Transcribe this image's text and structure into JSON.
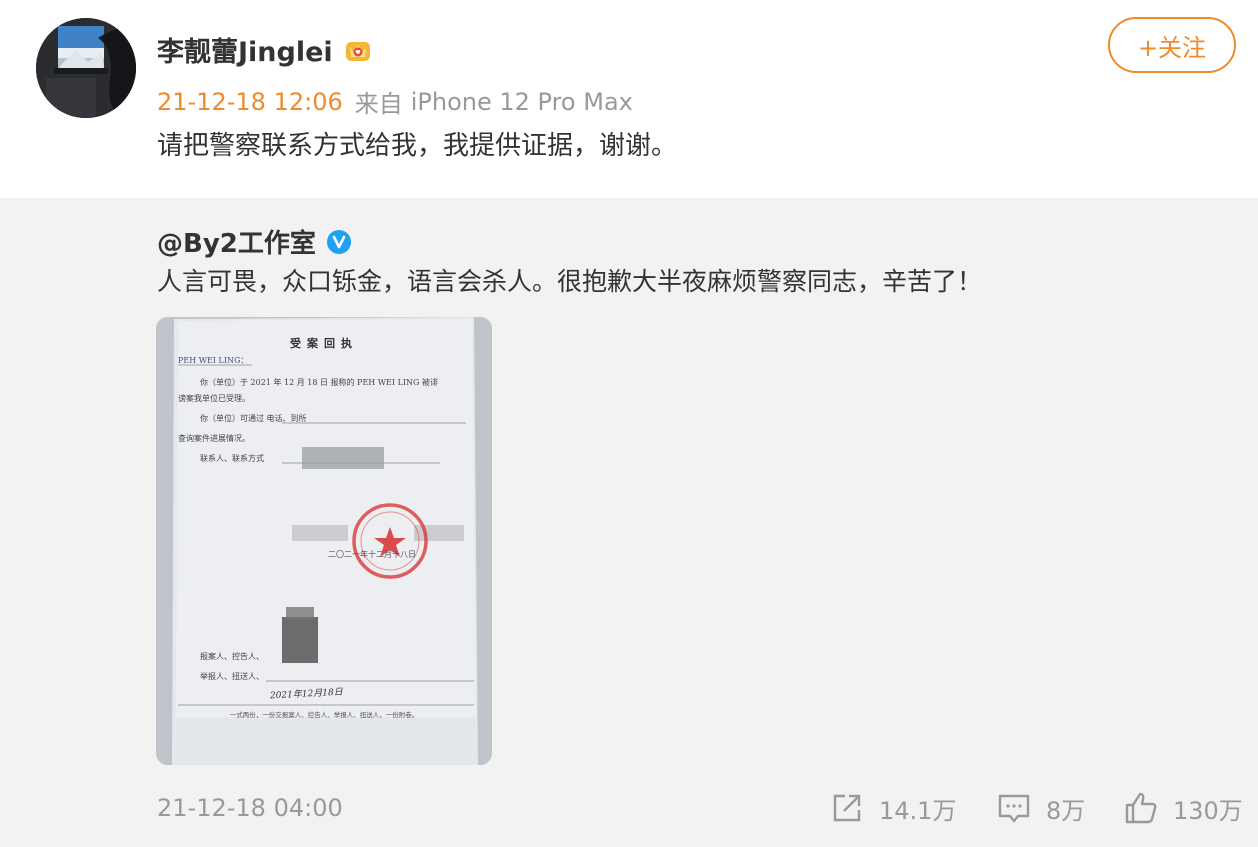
{
  "post": {
    "author": "李靓蕾Jinglei",
    "badge_icon": "crown-badge-icon",
    "follow_label": "+关注",
    "time": "21-12-18 12:06",
    "source_prefix": "来自",
    "device": "iPhone 12 Pro Max",
    "text": "请把警察联系方式给我，我提供证据，谢谢。"
  },
  "repost": {
    "author": "@By2工作室",
    "verified_icon": "verified-check-icon",
    "text": "人言可畏，众口铄金，语言会杀人。很抱歉大半夜麻烦警察同志，辛苦了！",
    "image": {
      "title": "受案回执",
      "line_name": "PEH WEI LING：",
      "line_1": "你（单位）于 2021 年 12 月 18 日 报称的 PEH WEI LING 被诽",
      "line_2": "谤案我单位已受理。",
      "line_3": "你（单位）可通过 电话、到所",
      "line_4": "查询案件进展情况。",
      "line_5": "联系人、联系方式",
      "date_line": "二〇二一年十二月十八日",
      "line_6": "报案人、控告人、",
      "line_7": "举报人、扭送人、",
      "hand_date": "2021年12月18日",
      "footer": "一式两份，一份交报案人、控告人、举报人、扭送人，一份附卷。"
    },
    "time": "21-12-18 04:00",
    "share_count": "14.1万",
    "comment_count": "8万",
    "like_count": "130万"
  },
  "colors": {
    "accent": "#f08a2a",
    "muted": "#999999",
    "repost_bg": "#f2f2f2",
    "verified": "#1da1f2",
    "stamp": "#d8393b"
  }
}
